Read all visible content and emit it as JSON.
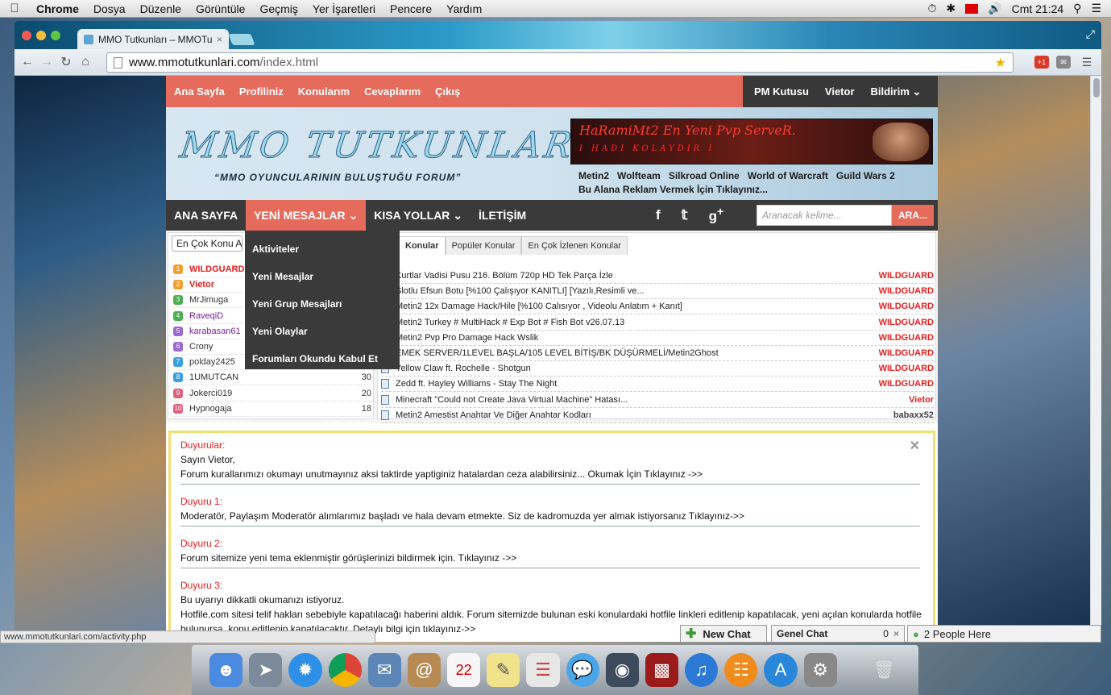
{
  "menubar": {
    "apple": "",
    "items": [
      "Chrome",
      "Dosya",
      "Düzenle",
      "Görüntüle",
      "Geçmiş",
      "Yer İşaretleri",
      "Pencere",
      "Yardım"
    ],
    "clock": "Cmt 21:24"
  },
  "browser": {
    "tab_title": "MMO Tutkunları – MMOTu",
    "url_domain": "www.mmotutkunlari.com",
    "url_path": "/index.html",
    "status_url": "www.mmotutkunlari.com/activity.php"
  },
  "site": {
    "topnav_left": [
      "Ana Sayfa",
      "Profiliniz",
      "Konularım",
      "Cevaplarım",
      "Çıkış"
    ],
    "topnav_right": {
      "pm": "PM Kutusu",
      "user": "Vietor",
      "notify": "Bildirim"
    },
    "logo": "MMO TUTKUNLARI",
    "slogan": "“MMO OYUNCULARININ BULUŞTUĞU FORUM”",
    "banner_title": "HaRamiMt2 En Yeni Pvp ServeR.",
    "banner_sub": "I HADI KOLAYDIR I",
    "game_links": [
      "Metin2",
      "Wolfteam",
      "Silkroad Online",
      "World of Warcraft",
      "Guild Wars 2"
    ],
    "ad_text": "Bu Alana Reklam Vermek İçin Tıklayınız...",
    "mainnav": [
      "ANA SAYFA",
      "YENİ MESAJLAR",
      "KISA YOLLAR",
      "İLETİŞİM"
    ],
    "search_placeholder": "Aranacak kelime...",
    "search_button": "ARA...",
    "dropdown": [
      "Aktiviteler",
      "Yeni Mesajlar",
      "Yeni Grup Mesajları",
      "Yeni Olaylar",
      "Forumları Okundu Kabul Et"
    ],
    "top_select": "En Çok Konu A",
    "users": [
      {
        "rank": "1",
        "name": "WILDGUARD",
        "count": "",
        "color": "#e52020",
        "badge": "#f0a030"
      },
      {
        "rank": "2",
        "name": "Vietor",
        "count": "",
        "color": "#e52020",
        "badge": "#f0a030"
      },
      {
        "rank": "3",
        "name": "MrJimuga",
        "count": "",
        "color": "#333",
        "badge": "#4caf50"
      },
      {
        "rank": "4",
        "name": "RaveqiD",
        "count": "",
        "color": "#7a1fa2",
        "badge": "#4caf50"
      },
      {
        "rank": "5",
        "name": "karabasan61",
        "count": "",
        "color": "#7a1fa2",
        "badge": "#9c6ad0"
      },
      {
        "rank": "6",
        "name": "Crony",
        "count": "",
        "color": "#333",
        "badge": "#9c6ad0"
      },
      {
        "rank": "7",
        "name": "polday2425",
        "count": "",
        "color": "#333",
        "badge": "#3aa0e0"
      },
      {
        "rank": "8",
        "name": "1UMUTCAN",
        "count": "30",
        "color": "#333",
        "badge": "#3aa0e0"
      },
      {
        "rank": "9",
        "name": "Jokerci019",
        "count": "20",
        "color": "#333",
        "badge": "#e06080"
      },
      {
        "rank": "10",
        "name": "Hypnogaja",
        "count": "18",
        "color": "#333",
        "badge": "#e06080"
      }
    ],
    "topic_tabs": [
      "Konular",
      "Popüler Konular",
      "En Çok İzlenen Konular"
    ],
    "topics": [
      {
        "title": "Kurtlar Vadisi Pusu 216. Bölüm 720p HD Tek Parça İzle",
        "author": "WILDGUARD"
      },
      {
        "title": "Slotlu Efsun Botu [%100 Çalışıyor KANITLI] [Yazılı,Resimli ve...",
        "author": "WILDGUARD"
      },
      {
        "title": "Metin2 12x Damage Hack/Hile [%100 Calısıyor , Videolu Anlatım + Kanıt]",
        "author": "WILDGUARD"
      },
      {
        "title": "Metin2 Turkey # MultiHack # Exp Bot # Fish Bot v26.07.13",
        "author": "WILDGUARD"
      },
      {
        "title": "Metin2 Pvp Pro Damage Hack Wslik",
        "author": "WILDGUARD"
      },
      {
        "title": "EMEK SERVER/1LEVEL BAŞLA/105 LEVEL BİTİŞ/BK DÜŞÜRMELİ/Metin2Ghost",
        "author": "WILDGUARD"
      },
      {
        "title": "Yellow Claw ft. Rochelle - Shotgun",
        "author": "WILDGUARD"
      },
      {
        "title": "Zedd ft. Hayley Williams - Stay The Night",
        "author": "WILDGUARD"
      },
      {
        "title": "Minecraft \"Could not Create Java Virtual Machine\" Hatası...",
        "author": "Vietor"
      },
      {
        "title": "Metin2 Amestist Anahtar Ve Diğer Anahtar Kodları",
        "author": "babaxx52"
      }
    ],
    "announcements": {
      "heading": "Duyurular:",
      "greeting": "Sayın Vietor,",
      "intro": "Forum kurallarımızı okumayı unutmayınız aksi taktirde yaptiginiz hatalardan ceza alabilirsiniz... Okumak İçin Tıklayınız ->>",
      "d1_h": "Duyuru 1:",
      "d1": "Moderatör, Paylaşım Moderatör alımlarımız başladı ve hala devam etmekte. Siz de kadromuzda yer almak istiyorsanız Tıklayınız->>",
      "d2_h": "Duyuru 2:",
      "d2": "Forum sitemize yeni tema eklenmiştir görüşlerinizi bildirmek için. Tıklayınız ->>",
      "d3_h": "Duyuru 3:",
      "d3a": "Bu uyarıyı dikkatli okumanızı istiyoruz.",
      "d3b": "Hotfile.com sitesi telif hakları sebebiyle kapatılacağı haberini aldık. Forum sitemizde bulunan eski konulardaki hotfile linkleri editlenip kapatılacak, yeni açılan konularda hotfile linki",
      "d3c": "bulunursa, konu editlenip kapatılacaktır. Detaylı bilgi için tıklayınız->>"
    }
  },
  "chat": {
    "new_chat": "New Chat",
    "genel": "Genel Chat",
    "genel_count": "0",
    "people": "2 People Here"
  },
  "colors": {
    "accent": "#e56b5c",
    "dark": "#3a3a3a",
    "alert_red": "#e52020",
    "announce_border": "#f1df72"
  }
}
